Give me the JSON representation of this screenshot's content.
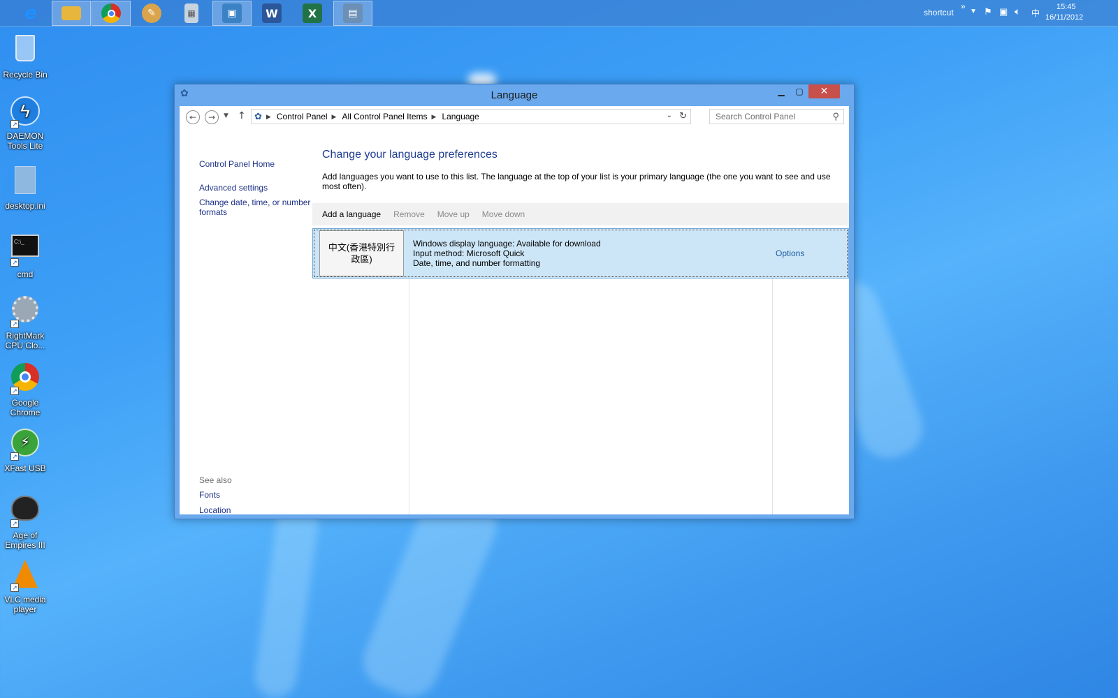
{
  "taskbar": {
    "apps": [
      {
        "name": "internet-explorer-icon",
        "glyph": "e",
        "color": "#1e90ff",
        "active": false
      },
      {
        "name": "file-explorer-icon",
        "glyph": "▭",
        "color": "#e7b63c",
        "active": true
      },
      {
        "name": "chrome-icon",
        "glyph": "◉",
        "color": "#d93025",
        "active": true
      },
      {
        "name": "paint-icon",
        "glyph": "✎",
        "color": "#d9a44c",
        "active": false
      },
      {
        "name": "calculator-icon",
        "glyph": "▦",
        "color": "#8aa0b8",
        "active": false
      },
      {
        "name": "control-panel-icon",
        "glyph": "▣",
        "color": "#3b82c4",
        "active": true
      },
      {
        "name": "word-icon",
        "glyph": "W",
        "color": "#2b579a",
        "active": false
      },
      {
        "name": "excel-icon",
        "glyph": "X",
        "color": "#217346",
        "active": false
      },
      {
        "name": "resource-monitor-icon",
        "glyph": "▤",
        "color": "#6b8fb5",
        "active": true
      }
    ],
    "tray": {
      "shortcut_label": "shortcut",
      "chevron": "»",
      "ime": "中",
      "time": "15:45",
      "date": "16/11/2012"
    }
  },
  "desktop": {
    "icons": [
      {
        "label": "Recycle Bin"
      },
      {
        "label": "DAEMON Tools Lite"
      },
      {
        "label": "desktop.ini"
      },
      {
        "label": "cmd"
      },
      {
        "label": "RightMark CPU Clo..."
      },
      {
        "label": "Google Chrome"
      },
      {
        "label": "XFast USB"
      },
      {
        "label": "Age of Empires III"
      },
      {
        "label": "VLC media player"
      }
    ]
  },
  "window": {
    "title": "Language",
    "address": {
      "crumbs": [
        "Control Panel",
        "All Control Panel Items",
        "Language"
      ]
    },
    "search_placeholder": "Search Control Panel",
    "leftnav": {
      "home": "Control Panel Home",
      "advanced": "Advanced settings",
      "datetime": "Change date, time, or number formats",
      "see_also": "See also",
      "fonts": "Fonts",
      "location": "Location"
    },
    "main": {
      "heading": "Change your language preferences",
      "description": "Add languages you want to use to this list. The language at the top of your list is your primary language (the one you want to see and use most often).",
      "toolbar": {
        "add": "Add a language",
        "remove": "Remove",
        "move_up": "Move up",
        "move_down": "Move down"
      },
      "languages": [
        {
          "name": "中文(香港特別行政區)",
          "line1": "Windows display language: Available for download",
          "line2": "Input method: Microsoft Quick",
          "line3": "Date, time, and number formatting",
          "options": "Options"
        }
      ]
    }
  }
}
